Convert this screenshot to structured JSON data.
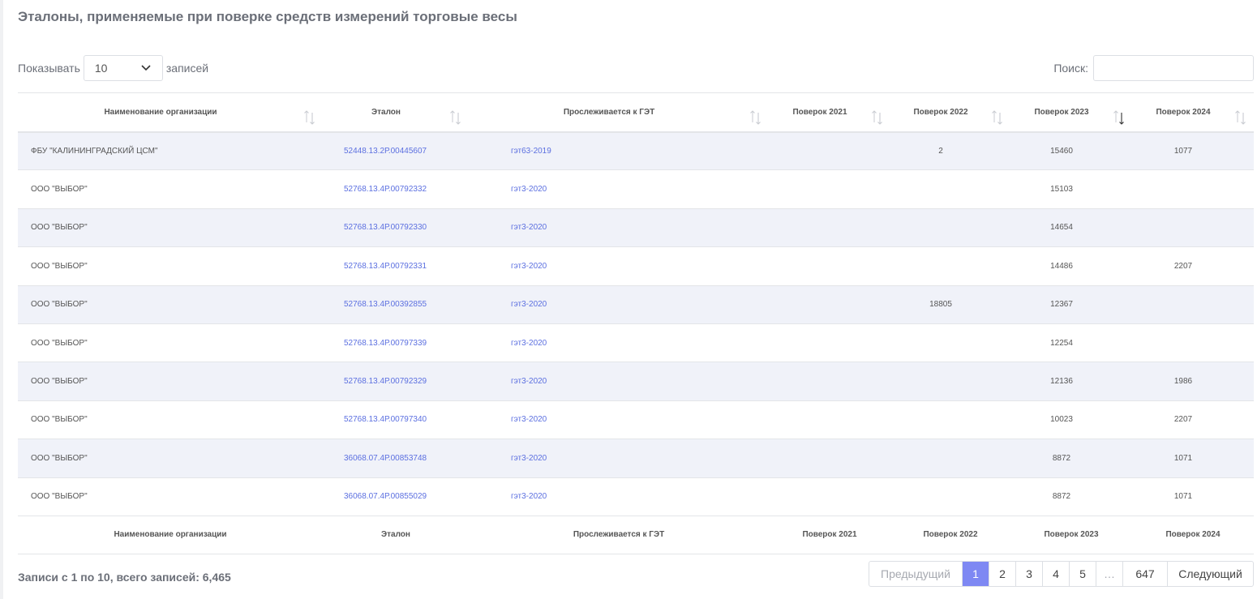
{
  "page": {
    "title": "Эталоны, применяемые при поверке средств измерений торговые весы"
  },
  "length_control": {
    "label_before": "Показывать",
    "selected": "10",
    "label_after": "записей"
  },
  "search": {
    "label": "Поиск:",
    "value": ""
  },
  "table": {
    "columns": [
      "Наименование организации",
      "Эталон",
      "Прослеживается к ГЭТ",
      "Поверок 2021",
      "Поверок 2022",
      "Поверок 2023",
      "Поверок 2024"
    ],
    "sorted_column_index": 5,
    "rows": [
      {
        "org": "ФБУ \"КАЛИНИНГРАДСКИЙ ЦСМ\"",
        "etalon": "52448.13.2Р.00445607",
        "get": "гэт63-2019",
        "y2021": "",
        "y2022": "2",
        "y2023": "15460",
        "y2024": "1077"
      },
      {
        "org": "ООО \"ВЫБОР\"",
        "etalon": "52768.13.4Р.00792332",
        "get": "гэт3-2020",
        "y2021": "",
        "y2022": "",
        "y2023": "15103",
        "y2024": ""
      },
      {
        "org": "ООО \"ВЫБОР\"",
        "etalon": "52768.13.4Р.00792330",
        "get": "гэт3-2020",
        "y2021": "",
        "y2022": "",
        "y2023": "14654",
        "y2024": ""
      },
      {
        "org": "ООО \"ВЫБОР\"",
        "etalon": "52768.13.4Р.00792331",
        "get": "гэт3-2020",
        "y2021": "",
        "y2022": "",
        "y2023": "14486",
        "y2024": "2207"
      },
      {
        "org": "ООО \"ВЫБОР\"",
        "etalon": "52768.13.4Р.00392855",
        "get": "гэт3-2020",
        "y2021": "",
        "y2022": "18805",
        "y2023": "12367",
        "y2024": ""
      },
      {
        "org": "ООО \"ВЫБОР\"",
        "etalon": "52768.13.4Р.00797339",
        "get": "гэт3-2020",
        "y2021": "",
        "y2022": "",
        "y2023": "12254",
        "y2024": ""
      },
      {
        "org": "ООО \"ВЫБОР\"",
        "etalon": "52768.13.4Р.00792329",
        "get": "гэт3-2020",
        "y2021": "",
        "y2022": "",
        "y2023": "12136",
        "y2024": "1986"
      },
      {
        "org": "ООО \"ВЫБОР\"",
        "etalon": "52768.13.4Р.00797340",
        "get": "гэт3-2020",
        "y2021": "",
        "y2022": "",
        "y2023": "10023",
        "y2024": "2207"
      },
      {
        "org": "ООО \"ВЫБОР\"",
        "etalon": "36068.07.4Р.00853748",
        "get": "гэт3-2020",
        "y2021": "",
        "y2022": "",
        "y2023": "8872",
        "y2024": "1071"
      },
      {
        "org": "ООО \"ВЫБОР\"",
        "etalon": "36068.07.4Р.00855029",
        "get": "гэт3-2020",
        "y2021": "",
        "y2022": "",
        "y2023": "8872",
        "y2024": "1071"
      }
    ]
  },
  "footer": {
    "info": "Записи с 1 по 10, всего записей: 6,465",
    "pagination": {
      "prev": "Предыдущий",
      "pages": [
        "1",
        "2",
        "3",
        "4",
        "5"
      ],
      "ellipsis": "…",
      "last": "647",
      "next": "Следующий",
      "active": "1"
    }
  },
  "colors": {
    "accent": "#7e88f3",
    "link": "#5b6fe0",
    "row_stripe": "#f0f2f9"
  }
}
